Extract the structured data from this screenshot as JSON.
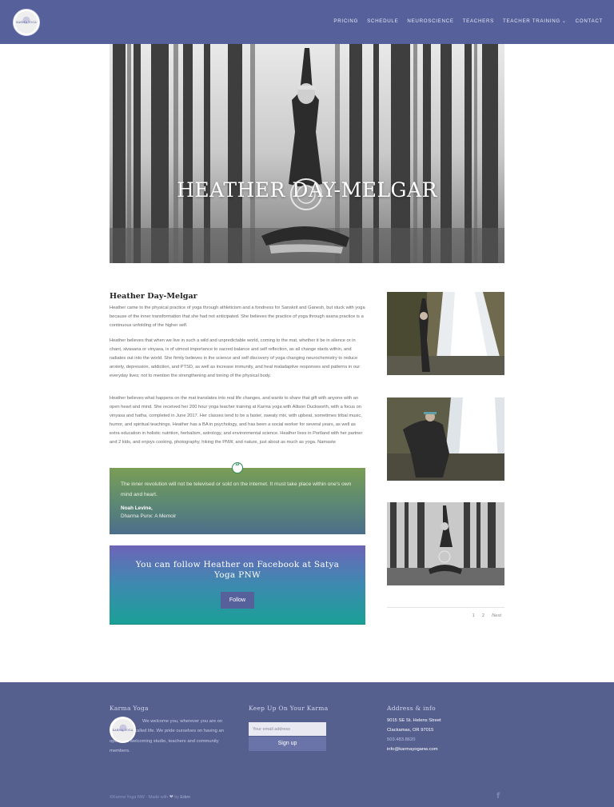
{
  "header": {
    "logo_text": "KARMA YOGA",
    "nav": [
      "PRICING",
      "SCHEDULE",
      "NEUROSCIENCE",
      "TEACHERS",
      "TEACHER TRAINING",
      "CONTACT"
    ],
    "nav_dropdown_caret": "⌄"
  },
  "hero": {
    "title": "HEATHER DAY-MELGAR"
  },
  "article": {
    "title": "Heather Day-Melgar",
    "paragraphs": [
      "Heather came to the physical practice of yoga through athleticism and a fondness for Sanskrit and Ganesh, but stuck with yoga because of the inner transformation that she had not anticipated. She believes the practice of yoga through asana practice is a continuous unfolding of the higher self.",
      "Heather believes that when we live in such a wild and unpredictable world, coming to the mat, whether it be in silence or in chant, sivasana or vinyasa, is of utmost importance to sacred balance and self reflection, as all change starts within, and radiates out into the world. She firmly believes in the science and self discovery of yoga changing neurochemistry to reduce anxiety, depression, addiction, and PTSD, as well as increase immunity, and heal maladaptive responses and patterns in our everyday lives; not to mention the strengthening and toning of the physical body.",
      "Heather believes what happens on the mat translates into real life changes, and wants to share that gift with anyone with an open heart and mind. She received her 200 hour yoga teacher training at Karma yoga with Allison Duckworth, with a focus on vinyasa and hatha, completed in June 2017. Her classes tend to be a faster, sweaty mix, with upbeat, sometimes tribal music, humor, and spiritual teachings. Heather has a BA in psychology, and has been a social worker for several years, as well as extra education in holistic nutrition, herbalism, astrology, and environmental science. Heather lives in Portland with her partner and 2 kids, and enjoys cooking, photography, hiking the PNW, and nature, just about as much as yoga. Namaste"
    ]
  },
  "quote": {
    "icon": "”",
    "text": "The inner revolution will not be televised or sold on the internet. It must take place within one's own mind and heart.",
    "author": "Noah Levine,",
    "source": "Dharma Punx: A Memoir"
  },
  "cta": {
    "title": "You can follow Heather on Facebook at Satya Yoga PNW",
    "button": "Follow"
  },
  "pagination": {
    "pages": [
      "1",
      "2"
    ],
    "next": "Next"
  },
  "footer": {
    "col1_title": "Karma Yoga",
    "about": "We welcome you, wherever you are on this journey called life. We pride ourselves on having an open and welcoming studio, teachers and community members.",
    "col2_title": "Keep Up On Your Karma",
    "email_placeholder": "Your email address",
    "signup": "Sign up",
    "col3_title": "Address & info",
    "address_line1": "9015 SE St. Helens Street",
    "address_line2": "Clackamas, OR 97015",
    "phone": "503.483.8620",
    "email": "info@karmayoganw.com",
    "copyright_prefix": "©Karma Yoga NW · Made with",
    "heart": "❤",
    "by": "by",
    "maker": "Eden",
    "facebook_icon": "f"
  },
  "colors": {
    "header": "#56609a",
    "footer": "#55608f",
    "quote_green": "#2f8a5a",
    "cta_teal": "#1aa096",
    "cta_purple": "#6d64b8"
  }
}
